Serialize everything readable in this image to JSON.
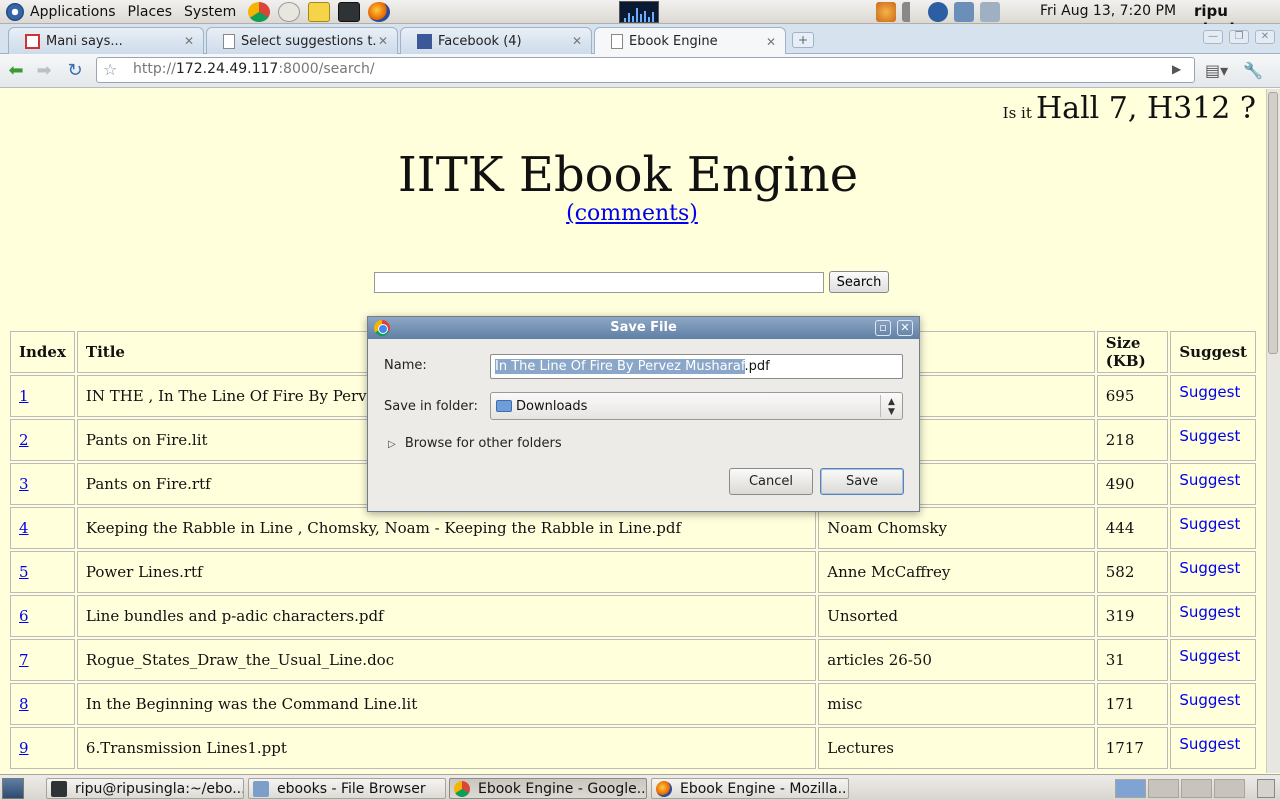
{
  "panel": {
    "menus": [
      "Applications",
      "Places",
      "System"
    ],
    "launchers": [
      "chrome-launcher-icon",
      "mail-clock-icon",
      "text-editor-icon",
      "terminal-icon",
      "firefox-icon"
    ],
    "clock": "Fri Aug 13,  7:20 PM",
    "user": "ripu singla"
  },
  "browser": {
    "tabs": [
      {
        "title": "Mani says...",
        "icon": "gmail-icon",
        "active": false
      },
      {
        "title": "Select suggestions t...",
        "icon": "page-icon",
        "active": false
      },
      {
        "title": "Facebook (4)",
        "icon": "facebook-icon",
        "active": false
      },
      {
        "title": "Ebook Engine",
        "icon": "page-icon",
        "active": true
      }
    ],
    "url_prefix": "http://",
    "url_host": "172.24.49.117",
    "url_rest": ":8000/search/"
  },
  "page": {
    "hall_prefix": "Is it",
    "hall_text": "Hall 7, H312 ?",
    "title": "IITK Ebook Engine",
    "comments_link": "(comments)",
    "search_value": "",
    "search_button": "Search",
    "table": {
      "headers": [
        "Index",
        "Title",
        "",
        "Size (KB)",
        "Suggest"
      ],
      "rows": [
        {
          "index": "1",
          "title": "IN THE ,   In The Line Of Fire By Pervez Musharaf.pdf",
          "author": "",
          "size": "695",
          "suggest": "Suggest"
        },
        {
          "index": "2",
          "title": "Pants on Fire.lit",
          "author": "",
          "size": "218",
          "suggest": "Suggest"
        },
        {
          "index": "3",
          "title": "Pants on Fire.rtf",
          "author": "",
          "size": "490",
          "suggest": "Suggest"
        },
        {
          "index": "4",
          "title": "Keeping the Rabble in Line ,   Chomsky, Noam - Keeping the Rabble in Line.pdf",
          "author": "Noam Chomsky",
          "size": "444",
          "suggest": "Suggest"
        },
        {
          "index": "5",
          "title": "Power Lines.rtf",
          "author": "Anne McCaffrey",
          "size": "582",
          "suggest": "Suggest"
        },
        {
          "index": "6",
          "title": "Line bundles and p-adic characters.pdf",
          "author": "Unsorted",
          "size": "319",
          "suggest": "Suggest"
        },
        {
          "index": "7",
          "title": "Rogue_States_Draw_the_Usual_Line.doc",
          "author": "articles 26-50",
          "size": "31",
          "suggest": "Suggest"
        },
        {
          "index": "8",
          "title": "In the Beginning was the Command Line.lit",
          "author": "misc",
          "size": "171",
          "suggest": "Suggest"
        },
        {
          "index": "9",
          "title": "6.Transmission Lines1.ppt",
          "author": "Lectures",
          "size": "1717",
          "suggest": "Suggest"
        }
      ]
    }
  },
  "dialog": {
    "title": "Save File",
    "name_label": "Name:",
    "name_selected": "In The Line Of Fire By Pervez Musharaf",
    "name_ext": ".pdf",
    "folder_label": "Save in folder:",
    "folder_value": "Downloads",
    "browse_label": "Browse for other folders",
    "cancel": "Cancel",
    "save": "Save"
  },
  "taskbar": [
    {
      "label": "ripu@ripusingla:~/ebo...",
      "icon": "terminal-icon",
      "active": false
    },
    {
      "label": "ebooks - File Browser",
      "icon": "file-browser-icon",
      "active": false
    },
    {
      "label": "Ebook Engine - Google...",
      "icon": "chrome-icon",
      "active": true
    },
    {
      "label": "Ebook Engine - Mozilla...",
      "icon": "firefox-icon",
      "active": false
    }
  ]
}
